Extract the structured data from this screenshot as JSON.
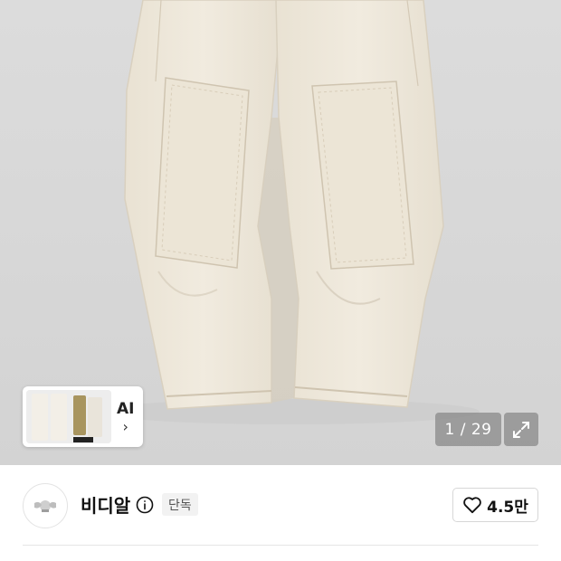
{
  "gallery": {
    "image_alt": "cream double-knee work pants",
    "counter_text": "1 / 29",
    "current_index": 1,
    "total_images": 29,
    "expand_icon": "expand-icon"
  },
  "ai_card": {
    "label": "AI",
    "chevron": "›"
  },
  "brand": {
    "name": "비디알",
    "info_icon": "info-icon",
    "badge": "단독",
    "like_count": "4.5만",
    "like_icon": "heart-icon"
  },
  "colors": {
    "hero_bg": "#d8d8d8",
    "pants_fabric": "#ede6d8",
    "counter_bg": "#8c8c8c",
    "badge_bg": "#f2f2f2"
  }
}
